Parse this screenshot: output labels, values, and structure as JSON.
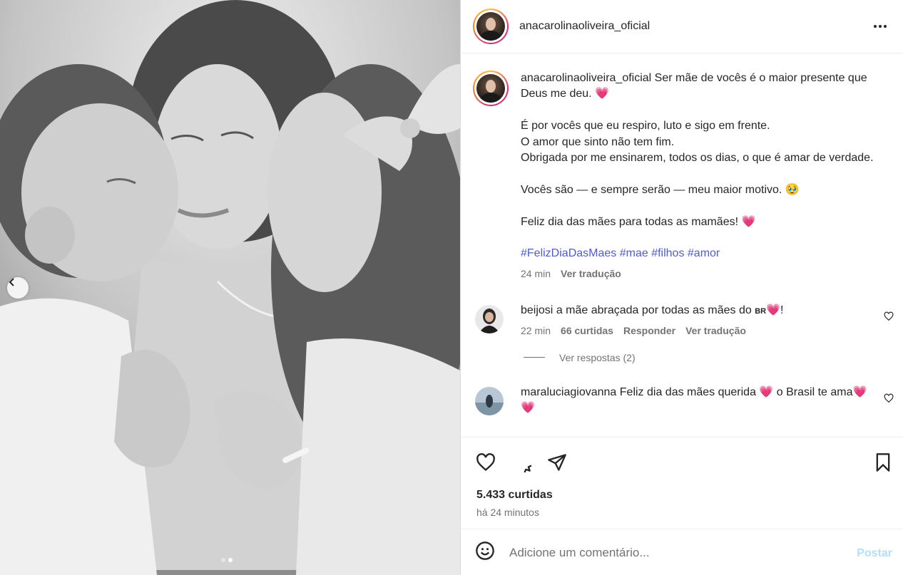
{
  "post": {
    "username": "anacarolinaoliveira_oficial",
    "caption": {
      "first_line": "Ser mãe de vocês é o maior presente que Deus me deu.",
      "para2": "É por vocês que eu respiro, luto e sigo em frente.\nO amor que sinto não tem fim.\nObrigada por me ensinarem, todos os dias, o que é amar de verdade.",
      "para3": "Vocês são — e sempre serão — meu maior motivo.",
      "para3_emoji": "🥹",
      "para4": "Feliz dia das mães para todas as mamães!",
      "hashtags": [
        "#FelizDiaDasMaes",
        "#mae",
        "#filhos",
        "#amor"
      ],
      "heart_emoji": "💗",
      "time": "24 min",
      "translate": "Ver tradução"
    },
    "comments": [
      {
        "username": "beijosi",
        "text": "a mãe abraçada por todas as mães do ",
        "flag": "BR",
        "suffix": "💗!",
        "time": "22 min",
        "likes": "66 curtidas",
        "reply": "Responder",
        "translate": "Ver tradução",
        "view_replies": "Ver respostas (2)"
      },
      {
        "username": "maraluciagiovanna",
        "text": "Feliz dia das mães querida 💗  o Brasil te ama💗 💗"
      }
    ],
    "likes": "5.433 curtidas",
    "posted": "há 24 minutos",
    "add_comment_placeholder": "Adicione um comentário...",
    "post_label": "Postar",
    "carousel": {
      "count": 2,
      "active": 2
    }
  },
  "icons": {
    "more": "more-options-icon",
    "like": "heart-icon",
    "comment": "comment-bubble-icon",
    "share": "send-icon",
    "save": "bookmark-icon",
    "emoji": "emoji-icon",
    "prev": "chevron-left-icon"
  },
  "colors": {
    "link": "#4f5bd5",
    "heart": "#ea3b6b",
    "post_disabled": "#b2dffc",
    "secondary": "#737373"
  }
}
